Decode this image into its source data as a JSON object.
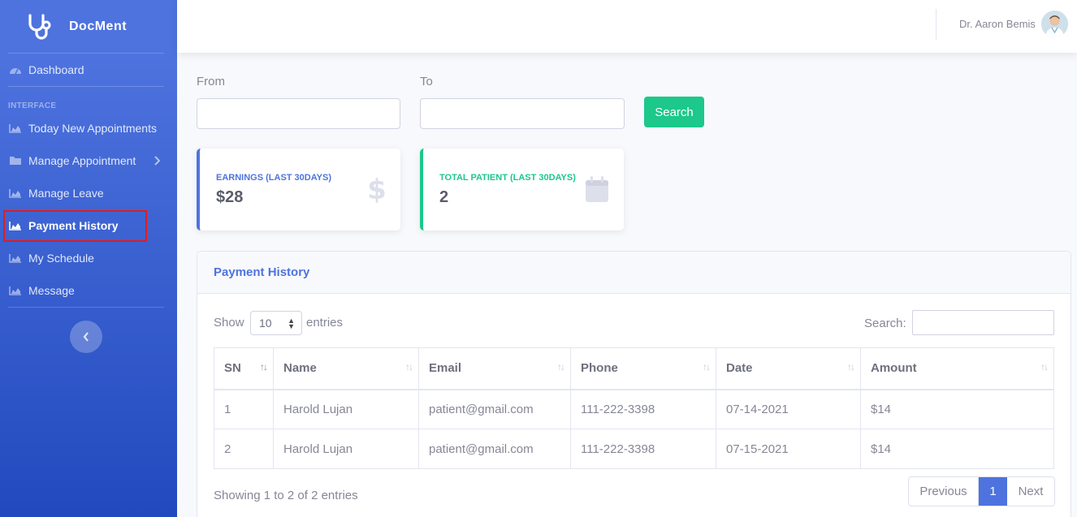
{
  "brand": {
    "name": "DocMent",
    "icon": "stethoscope-icon"
  },
  "sidebar": {
    "dashboard": {
      "label": "Dashboard",
      "icon": "dashboard-icon"
    },
    "heading": "INTERFACE",
    "items": [
      {
        "label": "Today New Appointments",
        "icon": "chart-area-icon"
      },
      {
        "label": "Manage Appointment",
        "icon": "folder-icon"
      },
      {
        "label": "Manage Leave",
        "icon": "chart-area-icon"
      },
      {
        "label": "Payment History",
        "icon": "chart-area-icon",
        "active": true
      },
      {
        "label": "My Schedule",
        "icon": "chart-area-icon"
      },
      {
        "label": "Message",
        "icon": "chart-area-icon"
      }
    ]
  },
  "topbar": {
    "user_name": "Dr. Aaron Bemis"
  },
  "filter": {
    "from_label": "From",
    "to_label": "To",
    "search_label": "Search"
  },
  "cards": [
    {
      "title": "EARNINGS (LAST 30DAYS)",
      "value": "$28",
      "icon": "dollar-icon",
      "color": "#4e73df"
    },
    {
      "title": "TOTAL PATIENT (LAST 30DAYS)",
      "value": "2",
      "icon": "calendar-icon",
      "color": "#1cc88a"
    }
  ],
  "panel": {
    "title": "Payment History",
    "show_label": "Show",
    "page_size": "10",
    "entries_label": "entries",
    "search_label": "Search:",
    "columns": [
      "SN",
      "Name",
      "Email",
      "Phone",
      "Date",
      "Amount"
    ],
    "rows": [
      [
        "1",
        "Harold Lujan",
        "patient@gmail.com",
        "111-222-3398",
        "07-14-2021",
        "$14"
      ],
      [
        "2",
        "Harold Lujan",
        "patient@gmail.com",
        "111-222-3398",
        "07-15-2021",
        "$14"
      ]
    ],
    "info": "Showing 1 to 2 of 2 entries",
    "pagination": {
      "previous": "Previous",
      "current": "1",
      "next": "Next"
    }
  }
}
